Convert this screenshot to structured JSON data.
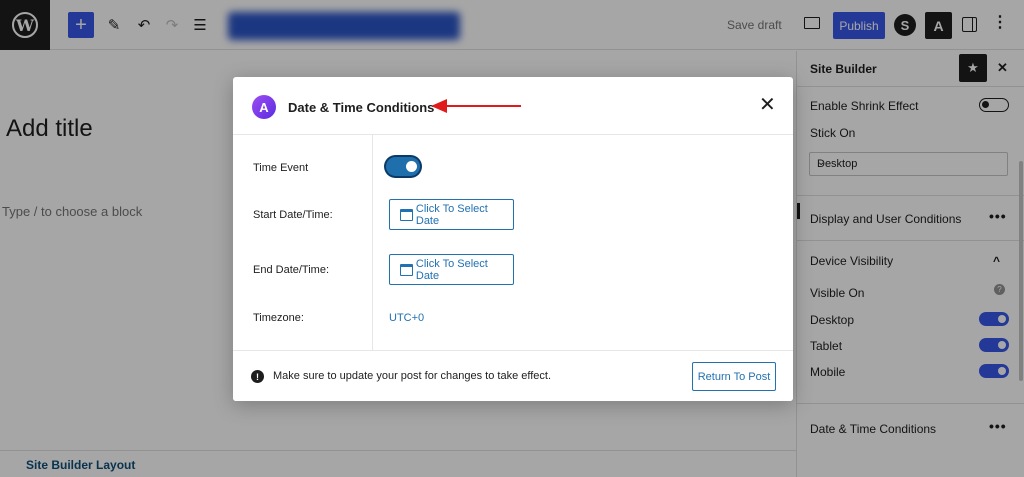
{
  "topbar": {
    "wp_logo": "W",
    "add_label": "+",
    "edit_icon": "✎",
    "undo_icon": "↶",
    "redo_icon": "↷",
    "list_icon": "☰",
    "save_draft": "Save draft",
    "publish": "Publish",
    "brand_s": "S",
    "brand_a": "A",
    "more_icon": "⋮"
  },
  "editor": {
    "title_placeholder": "Add title",
    "block_hint": "Type / to choose a block",
    "layout_label": "Site Builder Layout"
  },
  "sidebar": {
    "title": "Site Builder",
    "star": "★",
    "close": "✕",
    "shrink_label": "Enable Shrink Effect",
    "stick_on_label": "Stick On",
    "stick_on_value": "Desktop",
    "chevron": "⌄",
    "display_user_conditions": "Display and User Conditions",
    "dots": "•••",
    "device_visibility": "Device Visibility",
    "collapse": "^",
    "visible_on": "Visible On",
    "help": "?",
    "devices": [
      "Desktop",
      "Tablet",
      "Mobile"
    ],
    "date_time_conditions": "Date & Time Conditions"
  },
  "modal": {
    "logo": "A",
    "title": "Date & Time Conditions",
    "close": "✕",
    "time_event_label": "Time Event",
    "start_label": "Start Date/Time:",
    "end_label": "End Date/Time:",
    "select_date": "Click To Select Date",
    "timezone_label": "Timezone:",
    "timezone_value": "UTC+0",
    "warn_icon": "!",
    "warning": "Make sure to update your post for changes to take effect.",
    "return_button": "Return To Post"
  },
  "colors": {
    "accent": "#3858e9",
    "link": "#2271b1",
    "arrow": "#e01b1b"
  }
}
